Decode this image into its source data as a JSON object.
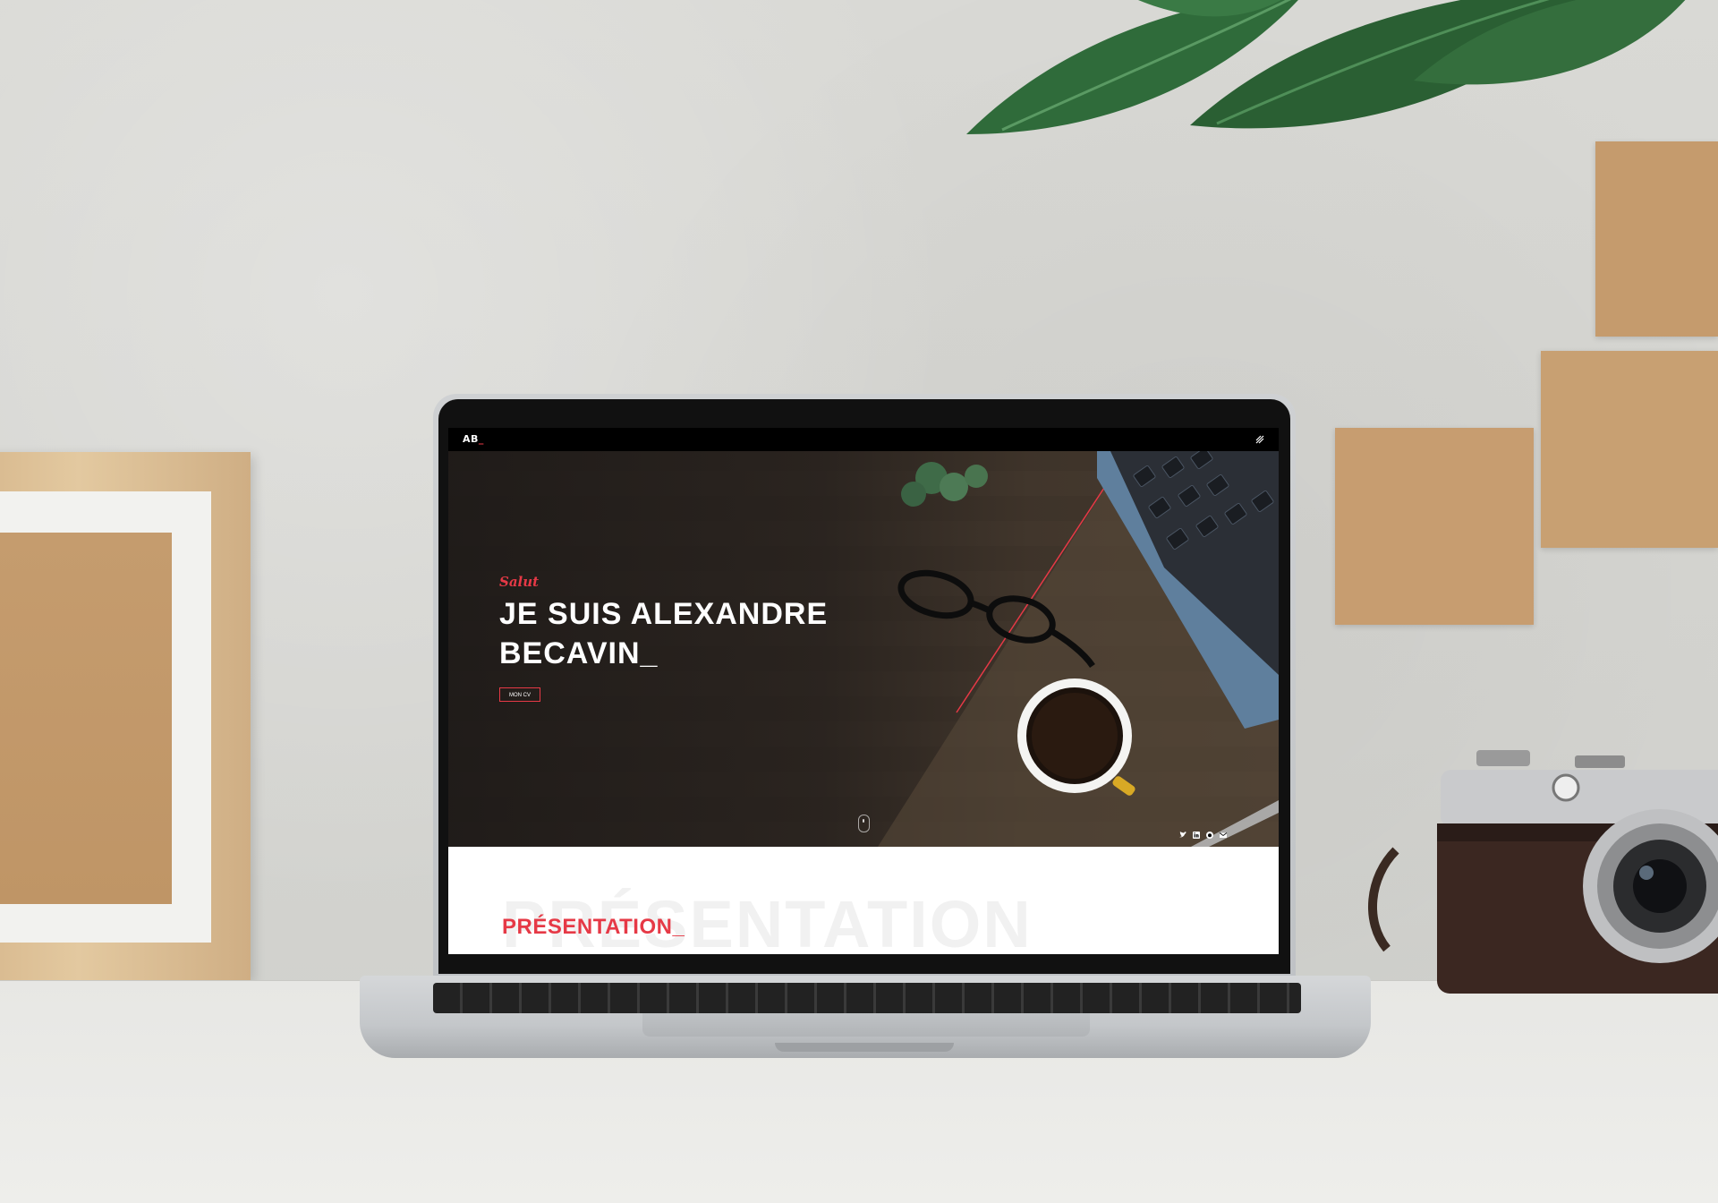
{
  "site": {
    "logo_text": "AB",
    "logo_suffix": "_",
    "hero": {
      "greeting": "Salut",
      "title": "JE SUIS ALEXANDRE BECAVIN_",
      "cv_button": "MON CV"
    },
    "presentation": {
      "ghost_text": "PRÉSENTATION",
      "title": "PRÉSENTATION_"
    },
    "socials": [
      "twitter-icon",
      "linkedin-icon",
      "github-icon",
      "mail-icon"
    ]
  },
  "colors": {
    "accent": "#e63946",
    "nav_background": "#000000",
    "hero_overlay": "#2f2721"
  }
}
